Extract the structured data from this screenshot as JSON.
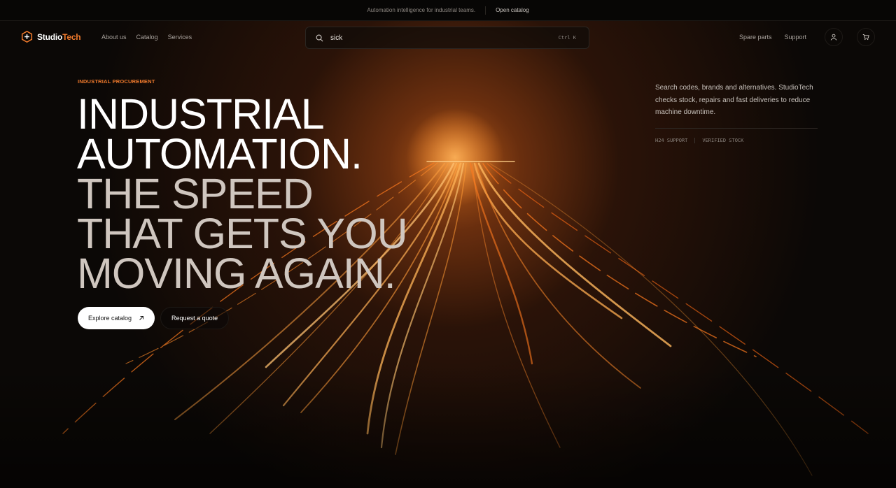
{
  "announcement": {
    "text": "Automation intelligence for industrial teams.",
    "link": "Open catalog"
  },
  "brand": {
    "name_main": "Studio",
    "name_accent": "Tech",
    "accent_color": "#f07a2c"
  },
  "nav": {
    "links": [
      "About us",
      "Catalog",
      "Services"
    ],
    "right_links": [
      "Spare parts",
      "Support"
    ],
    "icons": [
      "user-icon",
      "cart-icon"
    ]
  },
  "search": {
    "value": "sick",
    "shortcut": "Ctrl K"
  },
  "hero": {
    "eyebrow": "INDUSTRIAL PROCUREMENT",
    "headline_lines": [
      "INDUSTRIAL",
      "AUTOMATION.",
      "THE SPEED",
      "THAT GETS YOU",
      "MOVING AGAIN."
    ],
    "primary_cta": "Explore catalog",
    "secondary_cta": "Request a quote",
    "side_text": "Search codes, brands and alternatives. StudioTech checks stock, repairs and fast deliveries to reduce machine downtime.",
    "tags": [
      "H24 SUPPORT",
      "VERIFIED STOCK"
    ]
  }
}
